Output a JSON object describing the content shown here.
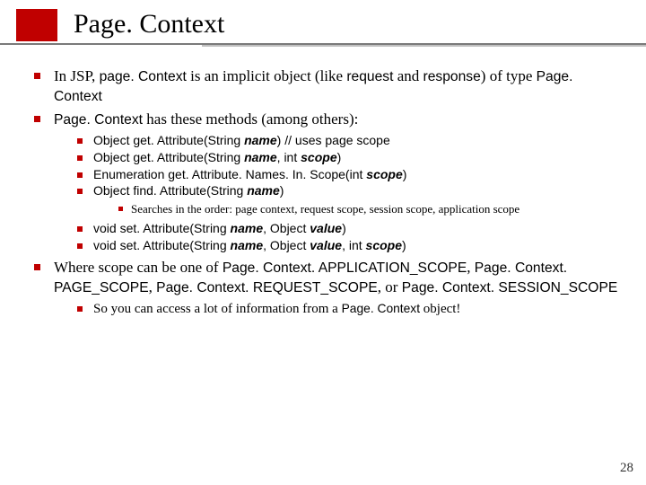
{
  "title": "Page. Context",
  "bullets": {
    "b1_pre": "In JSP, ",
    "b1_code1": "page. Context",
    "b1_mid1": " is an implicit object (like ",
    "b1_code2": "request",
    "b1_mid2": " and ",
    "b1_code3": "response",
    "b1_mid3": ") of type ",
    "b1_code4": "Page. Context",
    "b2_code": "Page. Context",
    "b2_rest": " has these methods (among others):",
    "m1_a": "Object get. Attribute(String ",
    "m1_name": "name",
    "m1_b": ") ",
    "m1_comment": "// uses page scope",
    "m2_a": "Object get. Attribute(String ",
    "m2_name": "name",
    "m2_b": ", int ",
    "m2_scope": "scope",
    "m2_c": ")",
    "m3_a": "Enumeration get. Attribute. Names. In. Scope(int ",
    "m3_scope": "scope",
    "m3_b": ")",
    "m4_a": "Object find. Attribute(String ",
    "m4_name": "name",
    "m4_b": ")",
    "m4_note": "Searches in the order: page context, request scope, session scope, application scope",
    "m5_a": "void set. Attribute(String ",
    "m5_name": "name",
    "m5_b": ", Object ",
    "m5_value": "value",
    "m5_c": ")",
    "m6_a": "void set. Attribute(String ",
    "m6_name": "name",
    "m6_b": ", Object ",
    "m6_value": "value",
    "m6_c": ", int ",
    "m6_scope": "scope",
    "m6_d": ")",
    "b3_a": "Where scope can be one of ",
    "b3_c1": "Page. Context. APPLICATION_SCOPE",
    "b3_s1": ", ",
    "b3_c2": "Page. Context. PAGE_SCOPE",
    "b3_s2": ", ",
    "b3_c3": "Page. Context. REQUEST_SCOPE",
    "b3_s3": ", or ",
    "b3_c4": "Page. Context. SESSION_SCOPE",
    "b3_note_a": "So you can access a lot of information from a ",
    "b3_note_code": "Page. Context",
    "b3_note_b": " object!"
  },
  "page_number": "28"
}
